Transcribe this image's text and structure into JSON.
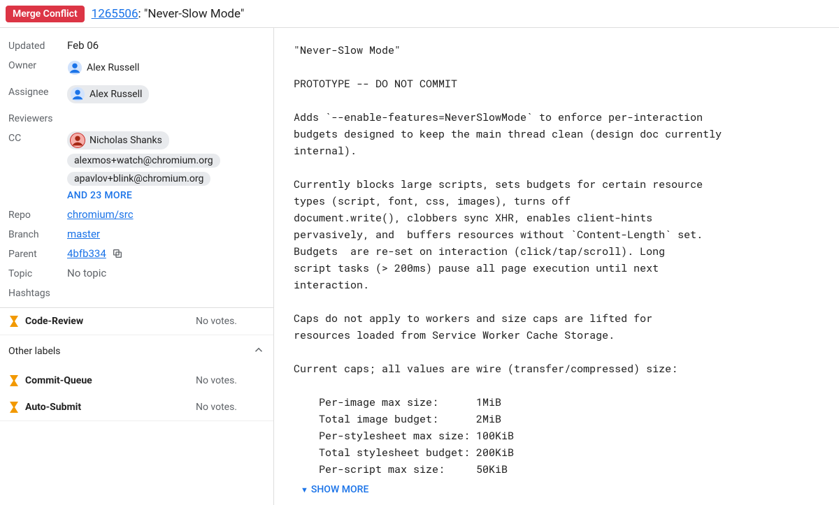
{
  "header": {
    "status": "Merge Conflict",
    "change_id": "1265506",
    "separator": ": ",
    "title": "\"Never-Slow Mode\""
  },
  "meta": {
    "updated_label": "Updated",
    "updated_value": "Feb 06",
    "owner_label": "Owner",
    "owner_name": "Alex Russell",
    "assignee_label": "Assignee",
    "assignee_name": "Alex Russell",
    "reviewers_label": "Reviewers",
    "cc_label": "CC",
    "cc": [
      "Nicholas Shanks",
      "alexmos+watch@chromium.org",
      "apavlov+blink@chromium.org"
    ],
    "cc_more": "AND 23 MORE",
    "repo_label": "Repo",
    "repo_value": "chromium/src",
    "branch_label": "Branch",
    "branch_value": "master",
    "parent_label": "Parent",
    "parent_value": "4bfb334",
    "topic_label": "Topic",
    "topic_value": "No topic",
    "hashtags_label": "Hashtags"
  },
  "votes": {
    "code_review_label": "Code-Review",
    "no_votes": "No votes.",
    "other_labels": "Other labels",
    "commit_queue_label": "Commit-Queue",
    "auto_submit_label": "Auto-Submit"
  },
  "commit_message": "\"Never-Slow Mode\"\n\nPROTOTYPE -- DO NOT COMMIT\n\nAdds `--enable-features=NeverSlowMode` to enforce per-interaction\nbudgets designed to keep the main thread clean (design doc currently\ninternal).\n\nCurrently blocks large scripts, sets budgets for certain resource\ntypes (script, font, css, images), turns off\ndocument.write(), clobbers sync XHR, enables client-hints\npervasively, and  buffers resources without `Content-Length` set.\nBudgets  are re-set on interaction (click/tap/scroll). Long\nscript tasks (> 200ms) pause all page execution until next\ninteraction.\n\nCaps do not apply to workers and size caps are lifted for\nresources loaded from Service Worker Cache Storage.\n\nCurrent caps; all values are wire (transfer/compressed) size:\n\n    Per-image max size:      1MiB\n    Total image budget:      2MiB\n    Per-stylesheet max size: 100KiB\n    Total stylesheet budget: 200KiB\n    Per-script max size:     50KiB",
  "show_more": "SHOW MORE"
}
